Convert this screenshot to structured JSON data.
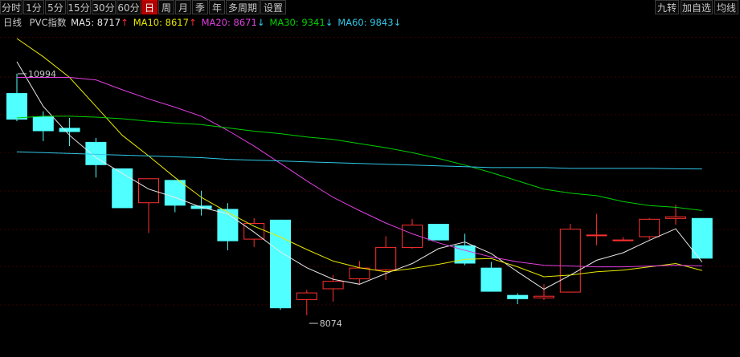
{
  "toolbar": {
    "periods": [
      "分时",
      "1分",
      "5分",
      "15分",
      "30分",
      "60分",
      "日",
      "周",
      "月",
      "季",
      "年",
      "多周期",
      "设置"
    ],
    "active_period": "日",
    "right": [
      "九转",
      "加自选",
      "均线"
    ]
  },
  "legend": {
    "period_label": "日线",
    "instrument": "PVC指数",
    "ma": [
      {
        "label": "MA5",
        "value": "8717",
        "arrow": "↑",
        "color": "#e8e8e8"
      },
      {
        "label": "MA10",
        "value": "8617",
        "arrow": "↑",
        "color": "#e8e800"
      },
      {
        "label": "MA20",
        "value": "8671",
        "arrow": "↓",
        "color": "#e040e0"
      },
      {
        "label": "MA30",
        "value": "9341",
        "arrow": "↓",
        "color": "#00d000"
      },
      {
        "label": "MA60",
        "value": "9843",
        "arrow": "↓",
        "color": "#30c8e8"
      }
    ],
    "arrow_up_color": "#ff3030",
    "arrow_down_color": "#30c8e8"
  },
  "colors": {
    "up": "#ff3030",
    "down": "#50ffff",
    "grid": "#3a0000",
    "bg": "#000000"
  },
  "chart_data": {
    "type": "candlestick",
    "price_range": [
      7900,
      11420
    ],
    "high_label": "10994",
    "low_label": "8074",
    "candles": [
      {
        "o": 10760,
        "h": 10994,
        "l": 10420,
        "c": 10440
      },
      {
        "o": 10480,
        "h": 10540,
        "l": 10180,
        "c": 10300
      },
      {
        "o": 10340,
        "h": 10460,
        "l": 10120,
        "c": 10290
      },
      {
        "o": 10170,
        "h": 10220,
        "l": 9740,
        "c": 9890
      },
      {
        "o": 9850,
        "h": 9850,
        "l": 9370,
        "c": 9370
      },
      {
        "o": 9430,
        "h": 9610,
        "l": 9070,
        "c": 9730
      },
      {
        "o": 9710,
        "h": 9710,
        "l": 9320,
        "c": 9400
      },
      {
        "o": 9400,
        "h": 9580,
        "l": 9280,
        "c": 9360
      },
      {
        "o": 9360,
        "h": 9430,
        "l": 8860,
        "c": 8970
      },
      {
        "o": 8990,
        "h": 9250,
        "l": 8900,
        "c": 9190
      },
      {
        "o": 9230,
        "h": 9230,
        "l": 8140,
        "c": 8160
      },
      {
        "o": 8260,
        "h": 8380,
        "l": 8074,
        "c": 8350
      },
      {
        "o": 8390,
        "h": 8560,
        "l": 8240,
        "c": 8490
      },
      {
        "o": 8510,
        "h": 8730,
        "l": 8450,
        "c": 8650
      },
      {
        "o": 8620,
        "h": 9030,
        "l": 8500,
        "c": 8900
      },
      {
        "o": 8890,
        "h": 9240,
        "l": 8880,
        "c": 9170
      },
      {
        "o": 9180,
        "h": 9180,
        "l": 8980,
        "c": 8980
      },
      {
        "o": 8920,
        "h": 9060,
        "l": 8680,
        "c": 8700
      },
      {
        "o": 8650,
        "h": 8720,
        "l": 8360,
        "c": 8360
      },
      {
        "o": 8320,
        "h": 8340,
        "l": 8210,
        "c": 8270
      },
      {
        "o": 8280,
        "h": 8450,
        "l": 8260,
        "c": 8310
      },
      {
        "o": 8350,
        "h": 9180,
        "l": 8350,
        "c": 9120
      },
      {
        "o": 9050,
        "h": 9300,
        "l": 8920,
        "c": 9050
      },
      {
        "o": 8980,
        "h": 9020,
        "l": 8980,
        "c": 8990
      },
      {
        "o": 9020,
        "h": 9250,
        "l": 8990,
        "c": 9240
      },
      {
        "o": 9240,
        "h": 9410,
        "l": 9170,
        "c": 9270
      },
      {
        "o": 9250,
        "h": 9250,
        "l": 8790,
        "c": 8760
      }
    ],
    "ma_lines": {
      "MA5": [
        11140,
        10600,
        10250,
        9980,
        9790,
        9600,
        9500,
        9380,
        9300,
        9080,
        8840,
        8650,
        8510,
        8450,
        8580,
        8700,
        8880,
        8960,
        8820,
        8600,
        8390,
        8560,
        8740,
        8830,
        8980,
        9120,
        8717
      ],
      "MA10": [
        11420,
        11200,
        10950,
        10600,
        10250,
        10000,
        9740,
        9500,
        9320,
        9150,
        9020,
        8870,
        8730,
        8650,
        8600,
        8640,
        8690,
        8750,
        8760,
        8660,
        8540,
        8560,
        8600,
        8620,
        8660,
        8700,
        8617
      ],
      "MA20": [
        10950,
        10950,
        10950,
        10920,
        10800,
        10690,
        10590,
        10480,
        10310,
        10120,
        9910,
        9700,
        9500,
        9340,
        9190,
        9060,
        8950,
        8860,
        8780,
        8720,
        8680,
        8670,
        8660,
        8660,
        8670,
        8680,
        8671
      ],
      "MA30": [
        10460,
        10480,
        10480,
        10470,
        10450,
        10420,
        10400,
        10380,
        10340,
        10300,
        10270,
        10230,
        10200,
        10150,
        10100,
        10040,
        9970,
        9890,
        9800,
        9700,
        9600,
        9550,
        9520,
        9450,
        9400,
        9380,
        9341
      ],
      "MA60": [
        10050,
        10040,
        10030,
        10020,
        10010,
        10000,
        9990,
        9980,
        9960,
        9950,
        9940,
        9930,
        9920,
        9910,
        9900,
        9890,
        9880,
        9870,
        9860,
        9860,
        9860,
        9850,
        9850,
        9850,
        9850,
        9845,
        9843
      ]
    }
  }
}
